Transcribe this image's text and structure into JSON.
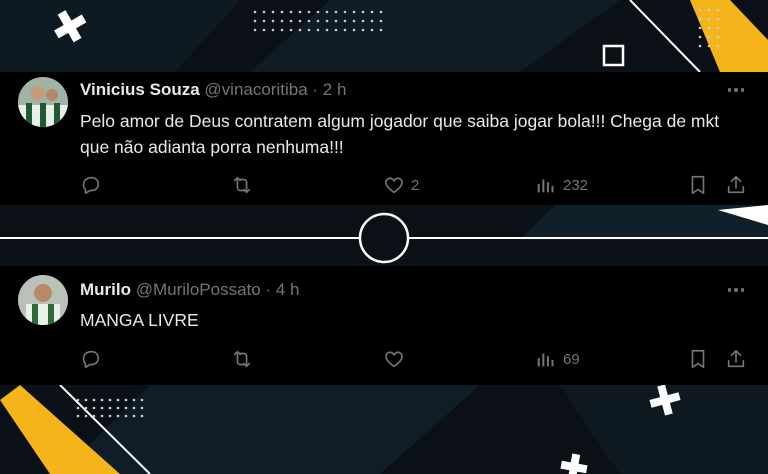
{
  "tweets": [
    {
      "name": "Vinicius Souza",
      "handle": "@vinacoritiba",
      "separator": "·",
      "time": "2 h",
      "text": "Pelo amor de Deus contratem algum jogador que saiba jogar bola!!! Chega de mkt que não adianta porra nenhuma!!!",
      "likes": "2",
      "views": "232"
    },
    {
      "name": "Murilo",
      "handle": "@MuriloPossato",
      "separator": "·",
      "time": "4 h",
      "text": "MANGA LIVRE",
      "likes": "",
      "views": "69"
    }
  ],
  "colors": {
    "background": "#0a1016",
    "card": "#000000",
    "text": "#e7e9ea",
    "muted": "#71767b",
    "accent_yellow": "#f4b41a"
  },
  "icons": [
    "reply-icon",
    "retweet-icon",
    "heart-icon",
    "views-icon",
    "bookmark-icon",
    "share-icon",
    "more-icon"
  ]
}
